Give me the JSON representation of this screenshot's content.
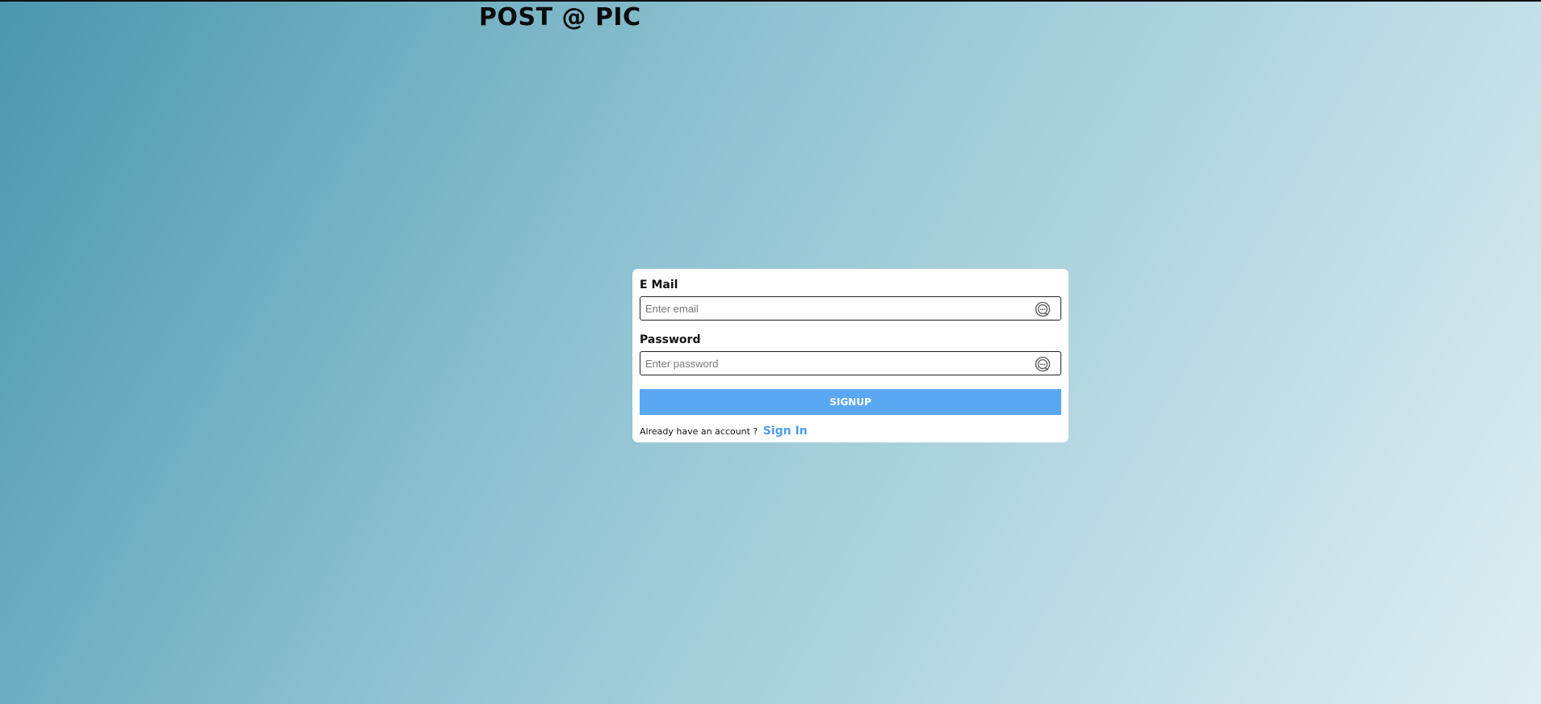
{
  "header": {
    "title": "POST @ PIC"
  },
  "form": {
    "email": {
      "label": "E Mail",
      "placeholder": "Enter email",
      "value": "",
      "icon": "password-manager-icon"
    },
    "password": {
      "label": "Password",
      "placeholder": "Enter password",
      "value": "",
      "icon": "password-manager-icon"
    },
    "submit_label": "SIGNUP",
    "footer_text": "Already have an account ?",
    "signin_label": "Sign In"
  },
  "colors": {
    "accent": "#5aa8f4",
    "link": "#4a9cf0",
    "background_start": "#4a97ae",
    "background_end": "#dfeef3"
  }
}
